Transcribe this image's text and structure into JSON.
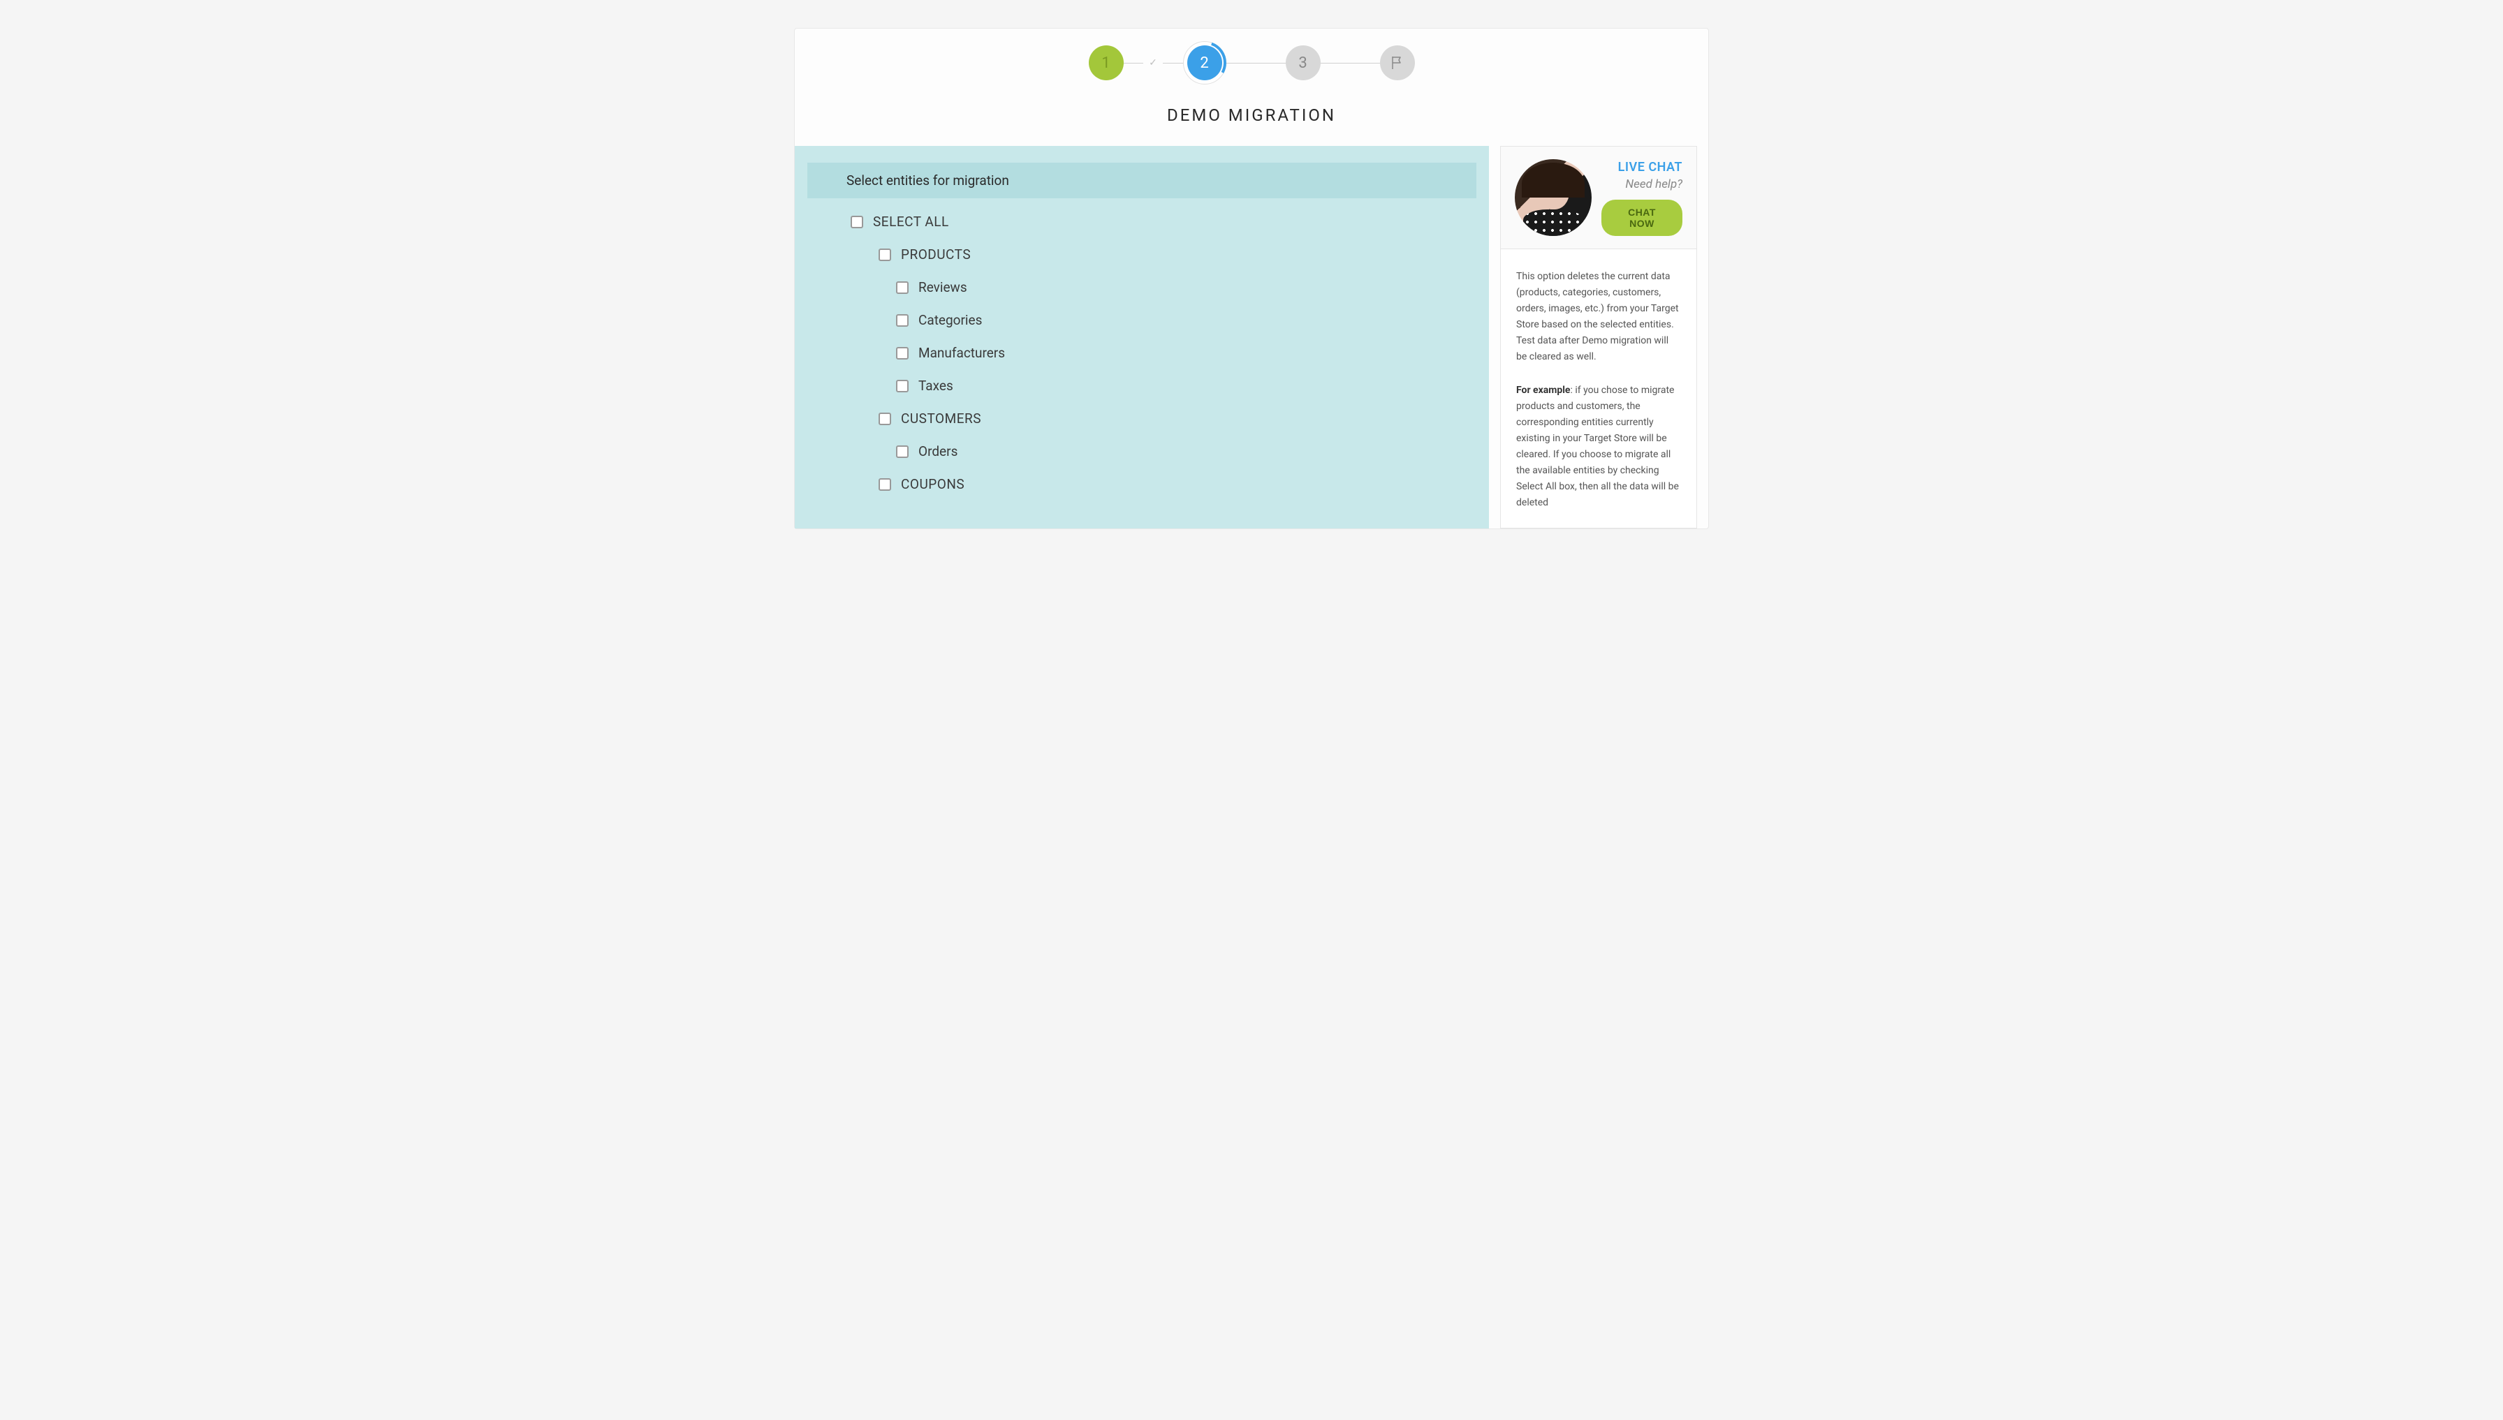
{
  "stepper": {
    "step1": "1",
    "step2": "2",
    "step3": "3"
  },
  "title": "DEMO MIGRATION",
  "section_header": "Select entities for migration",
  "entities": {
    "select_all": "SELECT ALL",
    "products": "PRODUCTS",
    "reviews": "Reviews",
    "categories": "Categories",
    "manufacturers": "Manufacturers",
    "taxes": "Taxes",
    "customers": "CUSTOMERS",
    "orders": "Orders",
    "coupons": "COUPONS"
  },
  "chat": {
    "title": "LIVE CHAT",
    "subtitle": "Need help?",
    "button": "CHAT NOW"
  },
  "info": {
    "para1": "This option deletes the current data (products, categories, customers, orders, images, etc.) from your Target Store based on the selected entities. Test data after Demo migration will be cleared as well.",
    "para2_bold": "For example",
    "para2_rest": ": if you chose to migrate products and customers, the corresponding entities currently existing in your Target Store will be cleared. If you choose to migrate all the available entities by checking Select All box, then all the data will be deleted"
  }
}
